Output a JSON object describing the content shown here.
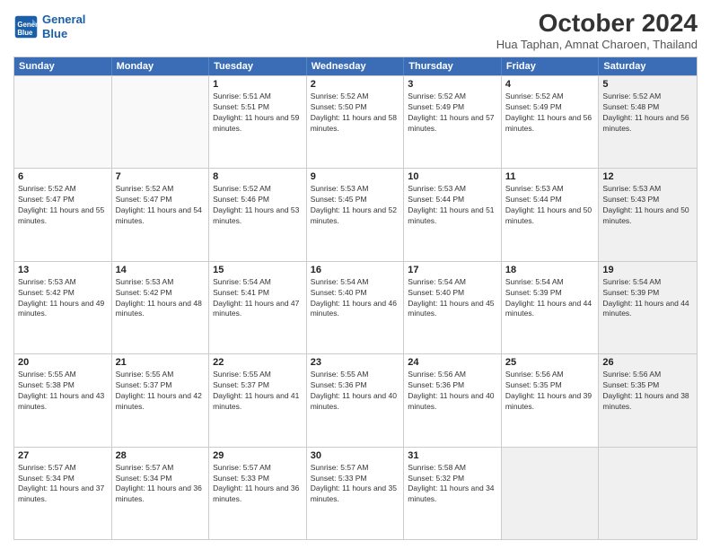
{
  "header": {
    "logo_line1": "General",
    "logo_line2": "Blue",
    "month": "October 2024",
    "location": "Hua Taphan, Amnat Charoen, Thailand"
  },
  "days_of_week": [
    "Sunday",
    "Monday",
    "Tuesday",
    "Wednesday",
    "Thursday",
    "Friday",
    "Saturday"
  ],
  "weeks": [
    [
      {
        "day": "",
        "empty": true
      },
      {
        "day": "",
        "empty": true
      },
      {
        "day": "1",
        "sunrise": "5:51 AM",
        "sunset": "5:51 PM",
        "daylight": "11 hours and 59 minutes."
      },
      {
        "day": "2",
        "sunrise": "5:52 AM",
        "sunset": "5:50 PM",
        "daylight": "11 hours and 58 minutes."
      },
      {
        "day": "3",
        "sunrise": "5:52 AM",
        "sunset": "5:49 PM",
        "daylight": "11 hours and 57 minutes."
      },
      {
        "day": "4",
        "sunrise": "5:52 AM",
        "sunset": "5:49 PM",
        "daylight": "11 hours and 56 minutes."
      },
      {
        "day": "5",
        "sunrise": "5:52 AM",
        "sunset": "5:48 PM",
        "daylight": "11 hours and 56 minutes.",
        "shaded": true
      }
    ],
    [
      {
        "day": "6",
        "sunrise": "5:52 AM",
        "sunset": "5:47 PM",
        "daylight": "11 hours and 55 minutes."
      },
      {
        "day": "7",
        "sunrise": "5:52 AM",
        "sunset": "5:47 PM",
        "daylight": "11 hours and 54 minutes."
      },
      {
        "day": "8",
        "sunrise": "5:52 AM",
        "sunset": "5:46 PM",
        "daylight": "11 hours and 53 minutes."
      },
      {
        "day": "9",
        "sunrise": "5:53 AM",
        "sunset": "5:45 PM",
        "daylight": "11 hours and 52 minutes."
      },
      {
        "day": "10",
        "sunrise": "5:53 AM",
        "sunset": "5:44 PM",
        "daylight": "11 hours and 51 minutes."
      },
      {
        "day": "11",
        "sunrise": "5:53 AM",
        "sunset": "5:44 PM",
        "daylight": "11 hours and 50 minutes."
      },
      {
        "day": "12",
        "sunrise": "5:53 AM",
        "sunset": "5:43 PM",
        "daylight": "11 hours and 50 minutes.",
        "shaded": true
      }
    ],
    [
      {
        "day": "13",
        "sunrise": "5:53 AM",
        "sunset": "5:42 PM",
        "daylight": "11 hours and 49 minutes."
      },
      {
        "day": "14",
        "sunrise": "5:53 AM",
        "sunset": "5:42 PM",
        "daylight": "11 hours and 48 minutes."
      },
      {
        "day": "15",
        "sunrise": "5:54 AM",
        "sunset": "5:41 PM",
        "daylight": "11 hours and 47 minutes."
      },
      {
        "day": "16",
        "sunrise": "5:54 AM",
        "sunset": "5:40 PM",
        "daylight": "11 hours and 46 minutes."
      },
      {
        "day": "17",
        "sunrise": "5:54 AM",
        "sunset": "5:40 PM",
        "daylight": "11 hours and 45 minutes."
      },
      {
        "day": "18",
        "sunrise": "5:54 AM",
        "sunset": "5:39 PM",
        "daylight": "11 hours and 44 minutes."
      },
      {
        "day": "19",
        "sunrise": "5:54 AM",
        "sunset": "5:39 PM",
        "daylight": "11 hours and 44 minutes.",
        "shaded": true
      }
    ],
    [
      {
        "day": "20",
        "sunrise": "5:55 AM",
        "sunset": "5:38 PM",
        "daylight": "11 hours and 43 minutes."
      },
      {
        "day": "21",
        "sunrise": "5:55 AM",
        "sunset": "5:37 PM",
        "daylight": "11 hours and 42 minutes."
      },
      {
        "day": "22",
        "sunrise": "5:55 AM",
        "sunset": "5:37 PM",
        "daylight": "11 hours and 41 minutes."
      },
      {
        "day": "23",
        "sunrise": "5:55 AM",
        "sunset": "5:36 PM",
        "daylight": "11 hours and 40 minutes."
      },
      {
        "day": "24",
        "sunrise": "5:56 AM",
        "sunset": "5:36 PM",
        "daylight": "11 hours and 40 minutes."
      },
      {
        "day": "25",
        "sunrise": "5:56 AM",
        "sunset": "5:35 PM",
        "daylight": "11 hours and 39 minutes."
      },
      {
        "day": "26",
        "sunrise": "5:56 AM",
        "sunset": "5:35 PM",
        "daylight": "11 hours and 38 minutes.",
        "shaded": true
      }
    ],
    [
      {
        "day": "27",
        "sunrise": "5:57 AM",
        "sunset": "5:34 PM",
        "daylight": "11 hours and 37 minutes."
      },
      {
        "day": "28",
        "sunrise": "5:57 AM",
        "sunset": "5:34 PM",
        "daylight": "11 hours and 36 minutes."
      },
      {
        "day": "29",
        "sunrise": "5:57 AM",
        "sunset": "5:33 PM",
        "daylight": "11 hours and 36 minutes."
      },
      {
        "day": "30",
        "sunrise": "5:57 AM",
        "sunset": "5:33 PM",
        "daylight": "11 hours and 35 minutes."
      },
      {
        "day": "31",
        "sunrise": "5:58 AM",
        "sunset": "5:32 PM",
        "daylight": "11 hours and 34 minutes."
      },
      {
        "day": "",
        "empty": true,
        "shaded": true
      },
      {
        "day": "",
        "empty": true,
        "shaded": true
      }
    ]
  ]
}
